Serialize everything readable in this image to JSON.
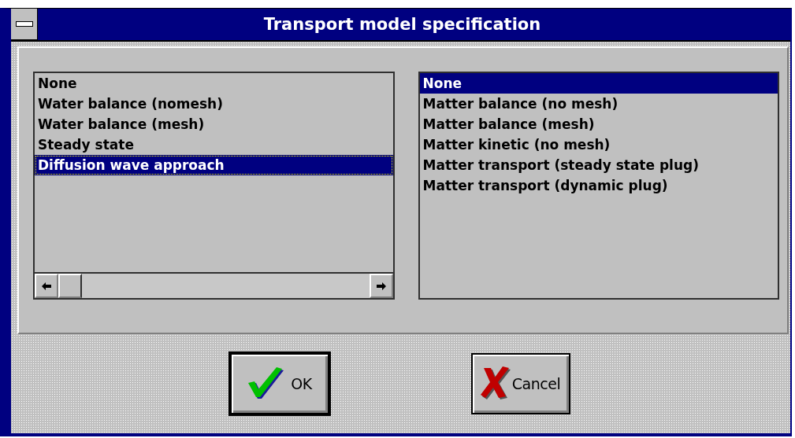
{
  "window": {
    "title": "Transport model specification"
  },
  "left_list": {
    "items": [
      {
        "label": "None",
        "selected": false
      },
      {
        "label": "Water balance (nomesh)",
        "selected": false
      },
      {
        "label": "Water balance (mesh)",
        "selected": false
      },
      {
        "label": "Steady state",
        "selected": false
      },
      {
        "label": "Diffusion wave approach",
        "selected": true
      }
    ]
  },
  "right_list": {
    "items": [
      {
        "label": "None",
        "selected": true
      },
      {
        "label": "Matter balance (no mesh)",
        "selected": false
      },
      {
        "label": "Matter balance (mesh)",
        "selected": false
      },
      {
        "label": "Matter kinetic (no mesh)",
        "selected": false
      },
      {
        "label": "Matter transport (steady state plug)",
        "selected": false
      },
      {
        "label": "Matter transport (dynamic plug)",
        "selected": false
      }
    ]
  },
  "buttons": [
    {
      "label": "OK",
      "kind": "ok",
      "default": true
    },
    {
      "label": "Cancel",
      "kind": "cancel",
      "default": false
    }
  ]
}
